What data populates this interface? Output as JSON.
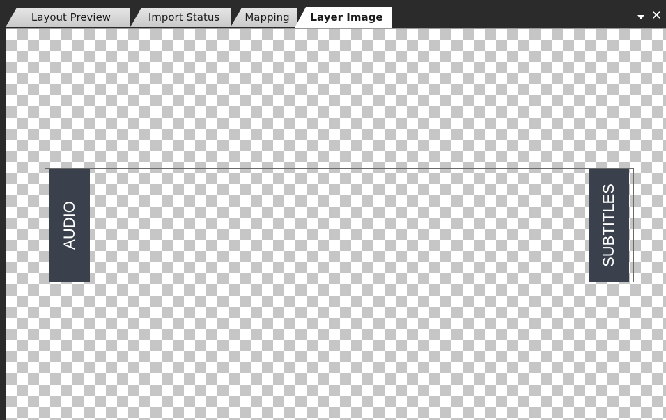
{
  "tabs": [
    {
      "label": "Layout Preview",
      "active": false
    },
    {
      "label": "Import Status",
      "active": false
    },
    {
      "label": "Mapping",
      "active": false
    },
    {
      "label": "Layer Image",
      "active": true
    }
  ],
  "controls": {
    "dropdown_icon": "chevron-down-icon",
    "close_icon": "close-icon",
    "close_glyph": "✕"
  },
  "layer": {
    "left_label": "AUDIO",
    "right_label": "SUBTITLES"
  },
  "colors": {
    "tabbar_bg": "#2b2b2b",
    "panel_bg": "#3a404c",
    "checker": "#c6c6c6"
  }
}
